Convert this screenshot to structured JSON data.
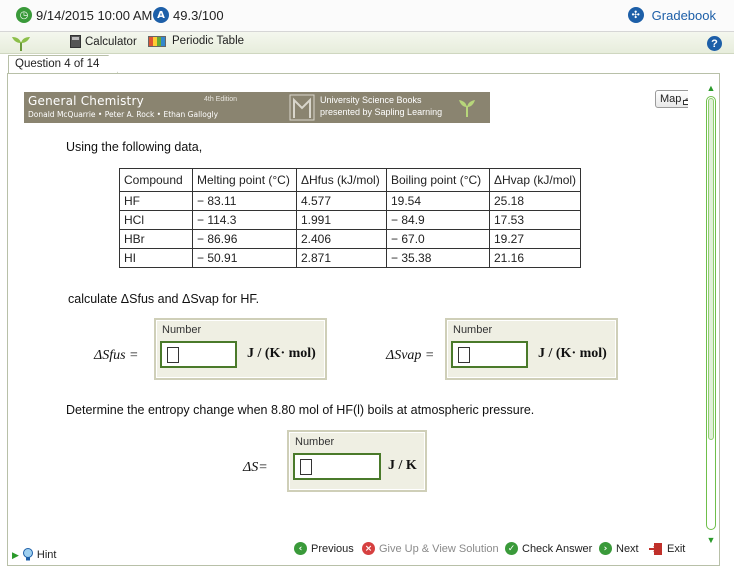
{
  "topbar": {
    "datetime": "9/14/2015 10:00 AM",
    "score": "49.3/100",
    "gradebook": "Gradebook"
  },
  "toolbar": {
    "calculator": "Calculator",
    "periodic_table": "Periodic Table",
    "help": "?"
  },
  "tab": {
    "label": "Question 4 of 14"
  },
  "banner": {
    "title": "General Chemistry",
    "edition": "4th Edition",
    "authors": "Donald McQuarrie • Peter A. Rock • Ethan Gallogly",
    "publisher_line1": "University Science Books",
    "publisher_line2": "presented by Sapling Learning"
  },
  "map_label": "Map",
  "question": {
    "intro": "Using the following data,",
    "table_headers": [
      "Compound",
      "Melting point (°C)",
      "ΔHfus (kJ/mol)",
      "Boiling point (°C)",
      "ΔHvap (kJ/mol)"
    ],
    "rows": [
      [
        "HF",
        "− 83.11",
        "4.577",
        "19.54",
        "25.18"
      ],
      [
        "HCl",
        "− 114.3",
        "1.991",
        "− 84.9",
        "17.53"
      ],
      [
        "HBr",
        "− 86.96",
        "2.406",
        "− 67.0",
        "19.27"
      ],
      [
        "HI",
        "− 50.91",
        "2.871",
        "− 35.38",
        "21.16"
      ]
    ],
    "prompt1": "calculate ΔSfus and ΔSvap for HF.",
    "prompt2": "Determine the entropy change when 8.80 mol of HF(l) boils at atmospheric pressure."
  },
  "answers": {
    "number_label": "Number",
    "s_fus_label": "ΔSfus =",
    "s_vap_label": "ΔSvap =",
    "s_label": "ΔS=",
    "unit_jkmol": "J / (K· mol)",
    "unit_jk": "J / K"
  },
  "footer": {
    "hint": "Hint",
    "previous": "Previous",
    "give_up": "Give Up & View Solution",
    "check_answer": "Check Answer",
    "next": "Next",
    "exit": "Exit"
  },
  "colors": {
    "gradebook_blue": "#1d5fa8",
    "banner_bg": "#8a8470",
    "field_border": "#4a7a2a",
    "accent_green": "#2a9a2a"
  }
}
